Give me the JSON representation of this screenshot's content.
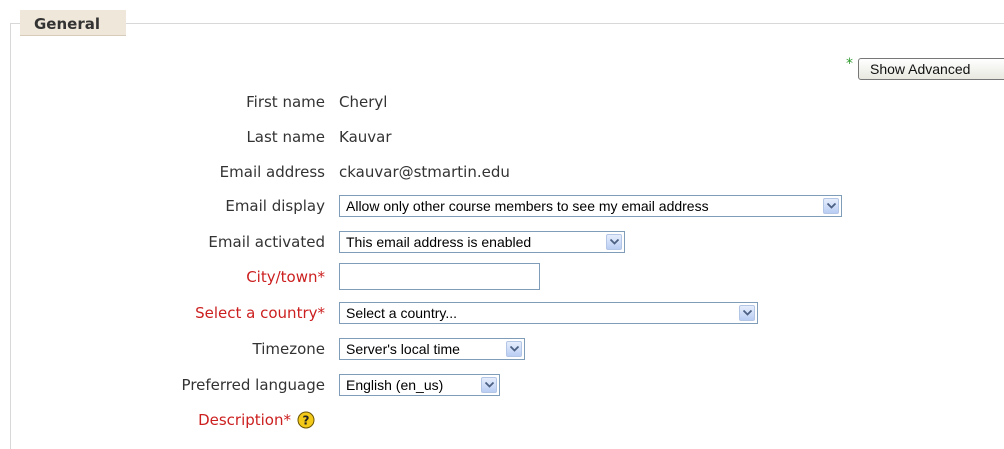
{
  "fieldset": {
    "legend": "General"
  },
  "advanced": {
    "required_marker": "*",
    "button_label": "Show Advanced"
  },
  "fields": {
    "first_name": {
      "label": "First name",
      "value": "Cheryl"
    },
    "last_name": {
      "label": "Last name",
      "value": "Kauvar"
    },
    "email_address": {
      "label": "Email address",
      "value": "ckauvar@stmartin.edu"
    },
    "email_display": {
      "label": "Email display",
      "selected": "Allow only other course members to see my email address"
    },
    "email_activated": {
      "label": "Email activated",
      "selected": "This email address is enabled"
    },
    "city": {
      "label": "City/town",
      "required_marker": "*",
      "value": ""
    },
    "country": {
      "label": "Select a country",
      "required_marker": "*",
      "selected": "Select a country..."
    },
    "timezone": {
      "label": "Timezone",
      "selected": "Server's local time"
    },
    "language": {
      "label": "Preferred language",
      "selected": "English (en_us)"
    },
    "description": {
      "label": "Description",
      "required_marker": "*"
    }
  },
  "icons": {
    "help": "help-icon",
    "dropdown": "chevron-down-icon"
  },
  "colors": {
    "required": "#cc1f1f",
    "legend_bg": "#efe7da",
    "advanced_marker": "#2c9a2c",
    "select_border": "#7f9db9"
  }
}
